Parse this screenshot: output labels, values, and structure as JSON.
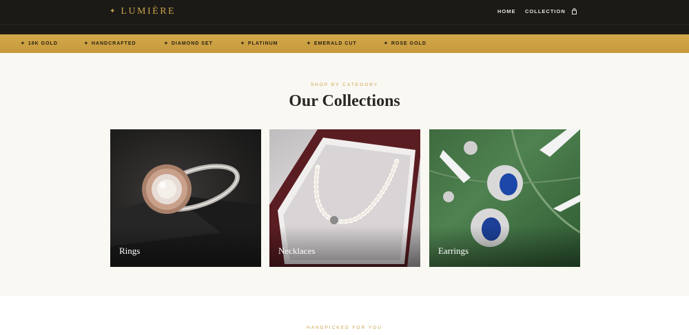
{
  "brand": {
    "star": "✦",
    "name": "LUMIÈRE"
  },
  "nav": {
    "home": "HOME",
    "collection": "COLLECTION",
    "cart_icon": "shopping-bag-icon"
  },
  "ticker": [
    {
      "star": "✦",
      "label": "18K GOLD"
    },
    {
      "star": "✦",
      "label": "HANDCRAFTED"
    },
    {
      "star": "✦",
      "label": "DIAMOND SET"
    },
    {
      "star": "✦",
      "label": "PLATINUM"
    },
    {
      "star": "✦",
      "label": "EMERALD CUT"
    },
    {
      "star": "✦",
      "label": "ROSE GOLD"
    }
  ],
  "collections": {
    "eyebrow": "SHOP BY CATEGORY",
    "title": "Our Collections",
    "cards": [
      {
        "label": "Rings"
      },
      {
        "label": "Necklaces"
      },
      {
        "label": "Earrings"
      }
    ]
  },
  "featured": {
    "eyebrow": "HANDPICKED FOR YOU"
  },
  "colors": {
    "gold": "#c9a24a",
    "dark": "#1c1a17",
    "cream": "#faf8f3"
  }
}
